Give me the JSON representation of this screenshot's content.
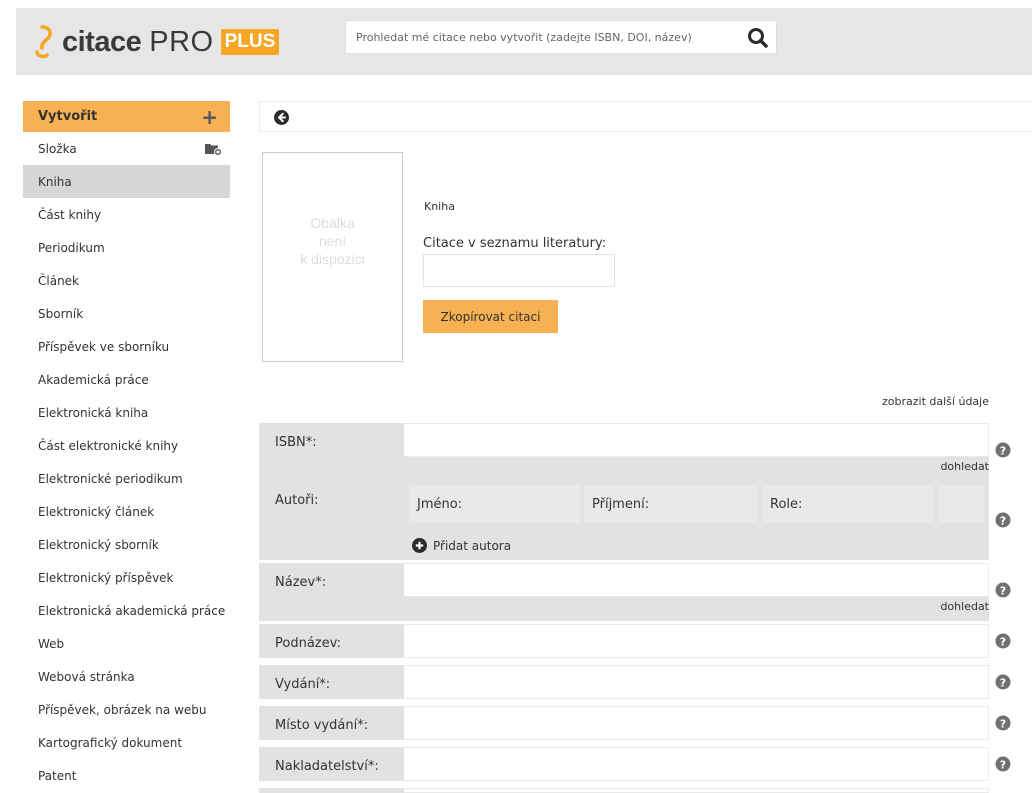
{
  "brand": {
    "name": "citace",
    "pro": "PRO",
    "plus": "PLUS",
    "accent_color": "#f8b152"
  },
  "search": {
    "placeholder": "Prohledat mé citace nebo vytvořit (zadejte ISBN, DOI, název)",
    "icon": "search-icon"
  },
  "sidebar": {
    "create_label": "Vytvořit",
    "create_icon": "plus-icon",
    "folder_label": "Složka",
    "folder_icon": "folder-add-icon",
    "items": [
      "Kniha",
      "Část knihy",
      "Periodikum",
      "Článek",
      "Sborník",
      "Příspěvek ve sborníku",
      "Akademická práce",
      "Elektronická kniha",
      "Část elektronické knihy",
      "Elektronické periodikum",
      "Elektronický článek",
      "Elektronický sborník",
      "Elektronický příspěvek",
      "Elektronická akademická práce",
      "Web",
      "Webová stránka",
      "Příspěvek, obrázek na webu",
      "Kartografický dokument",
      "Patent"
    ],
    "active_item": "Kniha"
  },
  "main": {
    "back_icon": "back-arrow-icon",
    "cover_text": "Obálka\nnení\nk dispozici",
    "type_label": "Kniha",
    "citation_label": "Citace v seznamu literatury:",
    "copy_button": "Zkopírovat citaci",
    "more_link": "zobrazit další údaje",
    "lookup_label": "dohledat",
    "fields": {
      "isbn": "ISBN*:",
      "authors": "Autoři:",
      "title": "Název*:",
      "subtitle": "Podnázev:",
      "edition": "Vydání*:",
      "place": "Místo vydání*:",
      "publisher": "Nakladatelství*:"
    },
    "author_columns": {
      "first_name": "Jméno:",
      "last_name": "Příjmení:",
      "role": "Role:"
    },
    "add_author": "Přidat autora"
  }
}
